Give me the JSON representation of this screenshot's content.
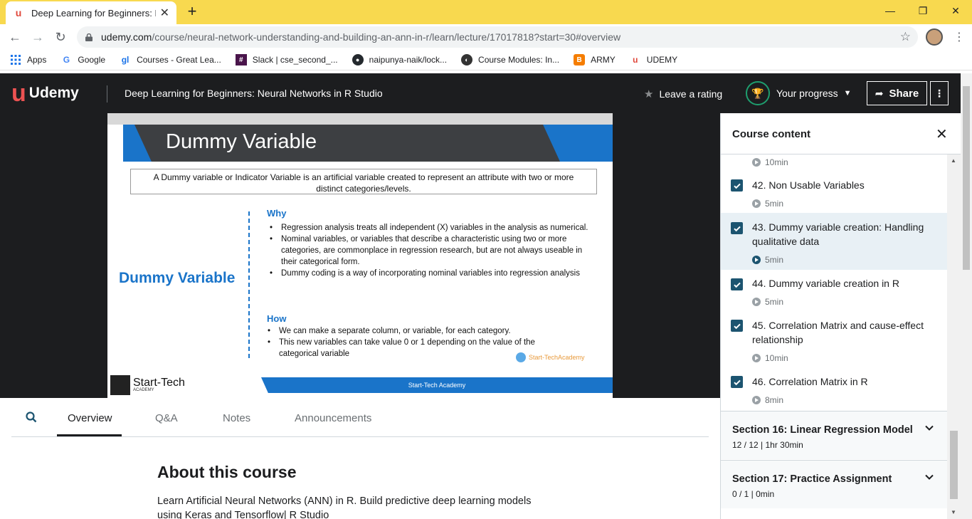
{
  "browser": {
    "tab_title": "Deep Learning for Beginners: Ne",
    "new_tab": "+",
    "url_host": "udemy.com",
    "url_path": "/course/neural-network-understanding-and-building-an-ann-in-r/learn/lecture/17017818?start=30#overview",
    "bookmarks": [
      {
        "label": "Apps",
        "icon": "apps-grid-icon"
      },
      {
        "label": "Google",
        "icon": "google-icon"
      },
      {
        "label": "Courses - Great Lea...",
        "icon": "great-learning-icon"
      },
      {
        "label": "Slack | cse_second_...",
        "icon": "slack-icon"
      },
      {
        "label": "naipunya-naik/lock...",
        "icon": "github-icon"
      },
      {
        "label": "Course Modules: In...",
        "icon": "globe-icon"
      },
      {
        "label": "ARMY",
        "icon": "blogger-icon"
      },
      {
        "label": "UDEMY",
        "icon": "udemy-icon"
      }
    ]
  },
  "header": {
    "logo_text": "Udemy",
    "course_title": "Deep Learning for Beginners: Neural Networks in R Studio",
    "rating_label": "Leave a rating",
    "progress_label": "Your progress",
    "share_label": "Share",
    "more": "⋮"
  },
  "slide": {
    "title": "Dummy Variable",
    "definition": "A Dummy variable or Indicator Variable is an artificial variable created to represent an attribute with two or more distinct categories/levels.",
    "big_label": "Dummy Variable",
    "why_head": "Why",
    "why_items": [
      "Regression analysis treats all independent (X) variables in the analysis as numerical.",
      "Nominal variables, or variables that describe a characteristic using two or more categories, are commonplace in regression research, but are not always useable in their categorical form.",
      "Dummy coding is a way of incorporating nominal variables into regression analysis"
    ],
    "how_head": "How",
    "how_items": [
      "We can make a separate column, or variable, for each category.",
      "This new variables can take value 0 or 1 depending on the value of the categorical variable"
    ],
    "footer_band": "Start-Tech Academy",
    "footer_logo": "Start-Tech",
    "footer_logo_sub": "ACADEMY",
    "watermark": "Start-TechAcademy"
  },
  "tabs": {
    "overview": "Overview",
    "qa": "Q&A",
    "notes": "Notes",
    "announcements": "Announcements"
  },
  "about": {
    "title": "About this course",
    "desc": "Learn Artificial Neural Networks (ANN) in R. Build predictive deep learning models using Keras and Tensorflow| R Studio"
  },
  "sidebar": {
    "title": "Course content",
    "partial_duration": "10min",
    "lectures": [
      {
        "title": "42. Non Usable Variables",
        "duration": "5min"
      },
      {
        "title": "43. Dummy variable creation: Handling qualitative data",
        "duration": "5min"
      },
      {
        "title": "44. Dummy variable creation in R",
        "duration": "5min"
      },
      {
        "title": "45. Correlation Matrix and cause-effect relationship",
        "duration": "10min"
      },
      {
        "title": "46. Correlation Matrix in R",
        "duration": "8min"
      }
    ],
    "sections": [
      {
        "title": "Section 16: Linear Regression Model",
        "meta": "12 / 12 | 1hr 30min"
      },
      {
        "title": "Section 17: Practice Assignment",
        "meta": "0 / 1 | 0min"
      }
    ]
  },
  "colors": {
    "tabbar": "#f8d94f",
    "udemy_red": "#ec5252",
    "header_bg": "#1c1d1f",
    "checkbox": "#1c5470",
    "slide_blue": "#1a74c9"
  }
}
